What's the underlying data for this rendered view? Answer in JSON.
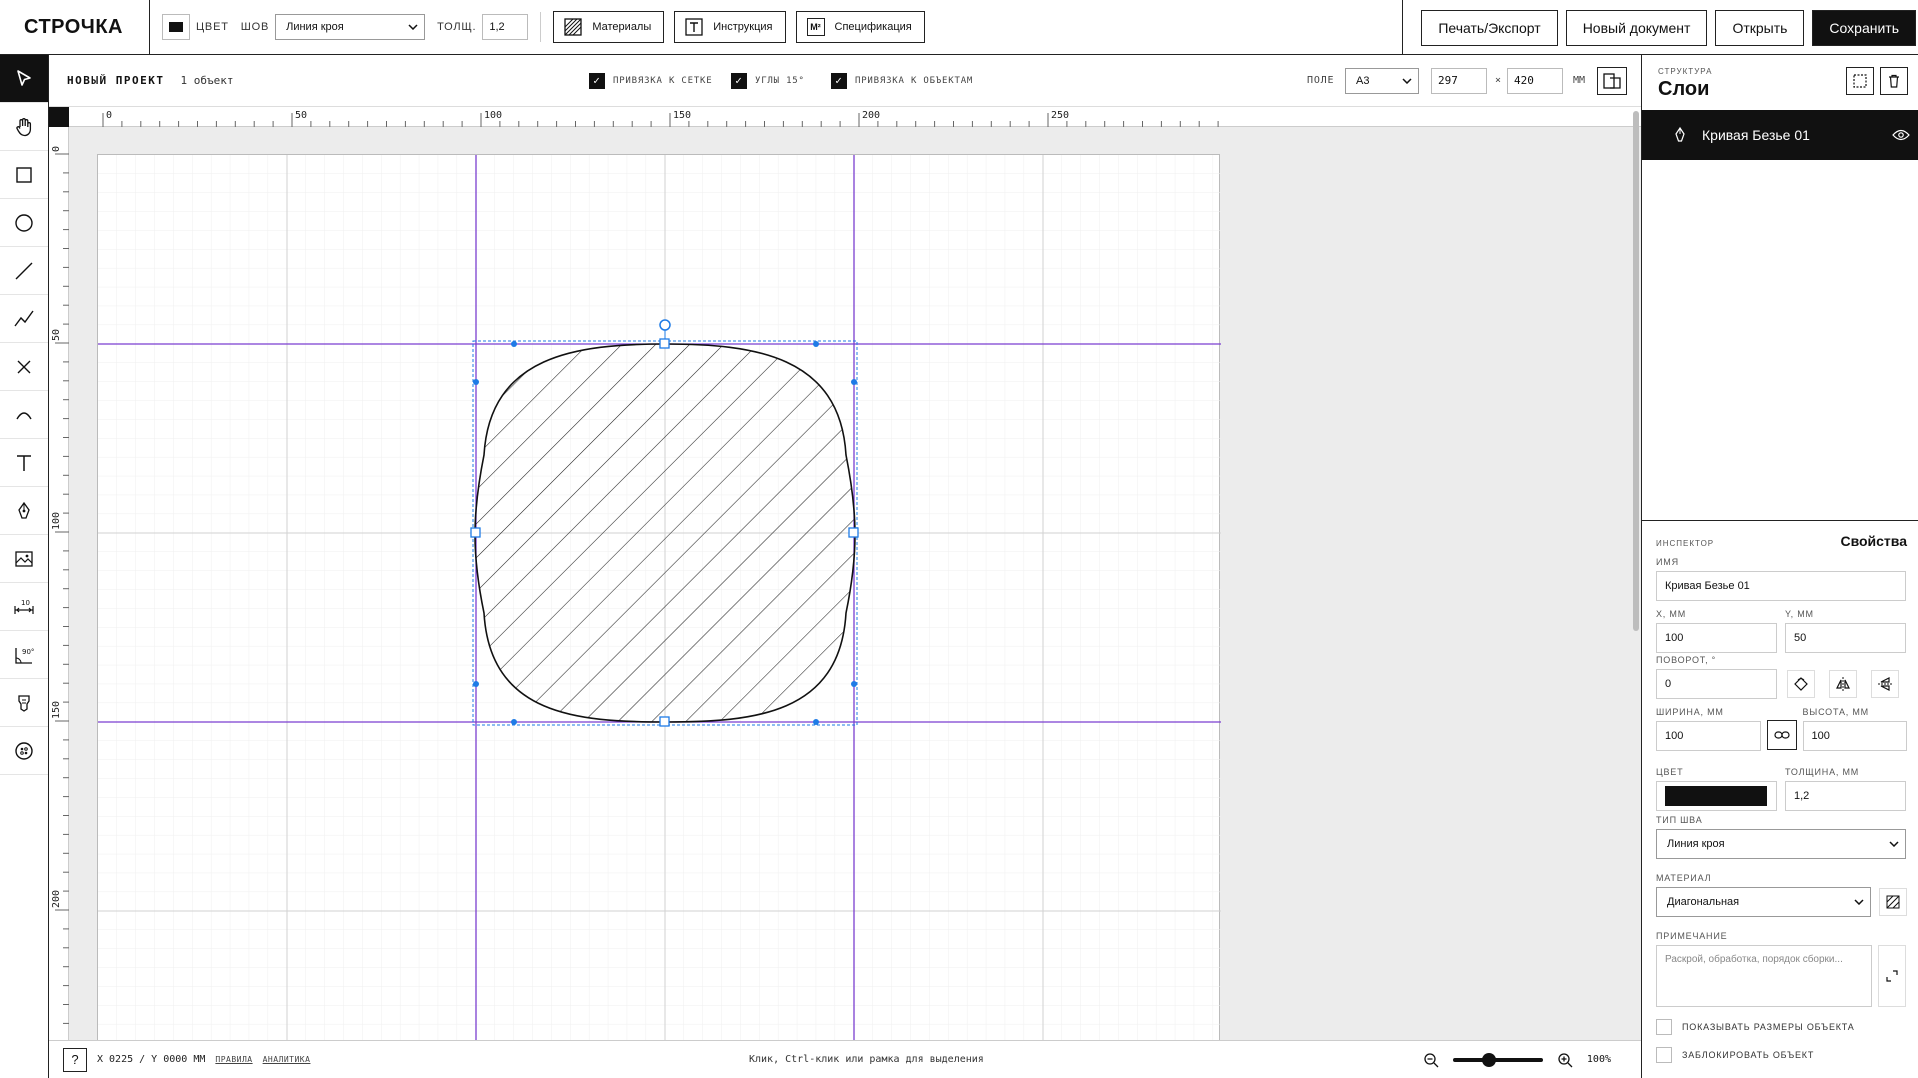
{
  "app": {
    "logo": "СТРОЧКА"
  },
  "toolbar": {
    "color_label": "ЦВЕТ",
    "color_value": "#111111",
    "seam_label": "ШОВ",
    "seam_value": "Линия кроя",
    "thickness_label": "ТОЛЩ.",
    "thickness_value": "1,2",
    "materials_label": "Материалы",
    "instruction_label": "Инструкция",
    "spec_label": "Спецификация",
    "spec_icon_text": "М²",
    "print_label": "Печать/Экспорт",
    "new_doc_label": "Новый документ",
    "open_label": "Открыть",
    "save_label": "Сохранить"
  },
  "left_tools": [
    "select-arrow-icon",
    "hand-icon",
    "rectangle-icon",
    "circle-icon",
    "line-icon",
    "polyline-icon",
    "cross-icon",
    "arc-icon",
    "text-icon",
    "pen-icon",
    "image-icon",
    "dimension-icon",
    "angle-icon",
    "button-notion-icon",
    "button-icon"
  ],
  "subbar": {
    "project_name": "НОВЫЙ ПРОЕКТ",
    "object_count": "1 объект",
    "snap_grid": "ПРИВЯЗКА К СЕТКЕ",
    "angles": "УГЛЫ 15°",
    "snap_objects": "ПРИВЯЗКА К ОБЪЕКТАМ",
    "field_label": "ПОЛЕ",
    "paper": "A3",
    "width": "297",
    "times": "×",
    "height": "420",
    "unit": "ММ"
  },
  "ruler": {
    "top_labels": [
      "0",
      "50",
      "100",
      "150",
      "200",
      "250"
    ],
    "left_labels": [
      "0",
      "50",
      "100",
      "150",
      "200"
    ]
  },
  "status": {
    "help": "?",
    "coords": "X 0225 / Y 0000 MM",
    "rules_link": "ПРАВИЛА",
    "analytics_link": "АНАЛИТИКА",
    "hint": "Клик, Ctrl-клик или рамка для выделения",
    "zoom": "100%"
  },
  "layers": {
    "section_label": "СТРУКТУРА",
    "title": "Слои",
    "items": [
      {
        "name": "Кривая Безье 01"
      }
    ]
  },
  "inspector": {
    "section_label": "ИНСПЕКТОР",
    "title": "Свойства",
    "name_label": "ИМЯ",
    "name_value": "Кривая Безье 01",
    "x_label": "X, ММ",
    "x_value": "100",
    "y_label": "Y, ММ",
    "y_value": "50",
    "rotation_label": "ПОВОРОТ, °",
    "rotation_value": "0",
    "width_label": "ШИРИНА, ММ",
    "width_value": "100",
    "height_label": "ВЫСОТА, ММ",
    "height_value": "100",
    "color_label": "ЦВЕТ",
    "color_value": "#111111",
    "thickness_label": "ТОЛЩИНА, ММ",
    "thickness_value": "1,2",
    "seam_label": "ТИП ШВА",
    "seam_value": "Линия кроя",
    "material_label": "МАТЕРИАЛ",
    "material_value": "Диагональная",
    "note_label": "ПРИМЕЧАНИЕ",
    "note_placeholder": "Раскрой, обработка, порядок сборки...",
    "show_dims": "ПОКАЗЫВАТЬ РАЗМЕРЫ ОБЪЕКТА",
    "lock": "ЗАБЛОКИРОВАТЬ ОБЪЕКТ"
  },
  "zoom_fraction": 0.4
}
